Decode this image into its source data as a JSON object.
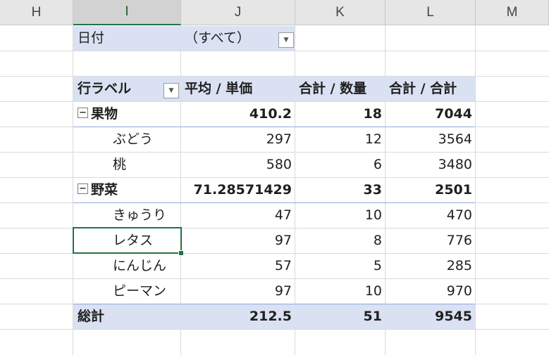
{
  "columns": [
    "H",
    "I",
    "J",
    "K",
    "L",
    "M"
  ],
  "filter": {
    "label": "日付",
    "value": "（すべて）"
  },
  "pivot": {
    "headers": {
      "row_label": "行ラベル",
      "avg_price": "平均 / 単価",
      "sum_qty": "合計 / 数量",
      "sum_total": "合計 / 合計"
    },
    "groups": [
      {
        "name": "果物",
        "avg": "410.2",
        "qty": "18",
        "total": "7044",
        "items": [
          {
            "name": "ぶどう",
            "avg": "297",
            "qty": "12",
            "total": "3564"
          },
          {
            "name": "桃",
            "avg": "580",
            "qty": "6",
            "total": "3480"
          }
        ]
      },
      {
        "name": "野菜",
        "avg": "71.28571429",
        "qty": "33",
        "total": "2501",
        "items": [
          {
            "name": "きゅうり",
            "avg": "47",
            "qty": "10",
            "total": "470"
          },
          {
            "name": "レタス",
            "avg": "97",
            "qty": "8",
            "total": "776"
          },
          {
            "name": "にんじん",
            "avg": "57",
            "qty": "5",
            "total": "285"
          },
          {
            "name": "ピーマン",
            "avg": "97",
            "qty": "10",
            "total": "970"
          }
        ]
      }
    ],
    "grand_total": {
      "label": "総計",
      "avg": "212.5",
      "qty": "51",
      "total": "9545"
    }
  },
  "icons": {
    "dropdown": "dropdown-arrow-icon",
    "collapse": "minus-box-icon"
  },
  "colors": {
    "header_band": "#d9e1f2",
    "selection": "#217346"
  }
}
